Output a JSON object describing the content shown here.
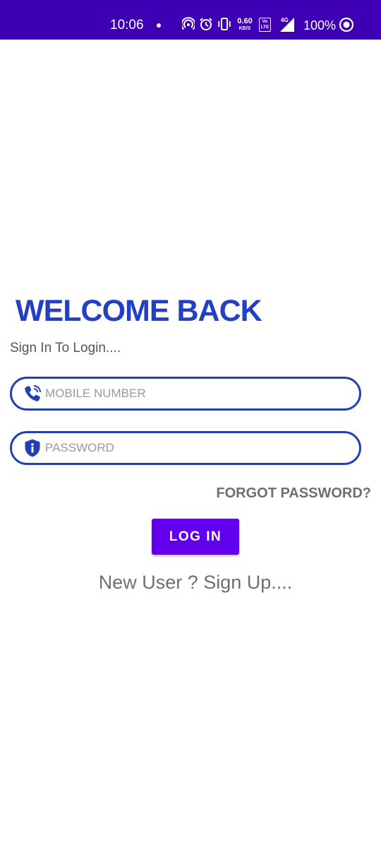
{
  "status_bar": {
    "time": "10:06",
    "net_speed_value": "0.60",
    "net_speed_unit": "KB/S",
    "volte": "Vo LTE",
    "network_type": "4G",
    "battery": "100%",
    "background_color": "#3f00b5"
  },
  "login": {
    "title": "WELCOME BACK",
    "subtitle": "Sign In To Login....",
    "mobile_placeholder": "MOBILE NUMBER",
    "mobile_value": "",
    "mobile_icon": "phone-icon",
    "password_placeholder": "PASSWORD",
    "password_value": "",
    "password_icon": "shield-info-icon",
    "forgot_label": "FORGOT PASSWORD?",
    "login_label": "LOG IN",
    "signup_label": "New User ? Sign Up...."
  },
  "colors": {
    "title": "#2340c2",
    "field_border": "#2340b0",
    "button": "#6200ee",
    "secondary_text": "#6f6f6f"
  }
}
